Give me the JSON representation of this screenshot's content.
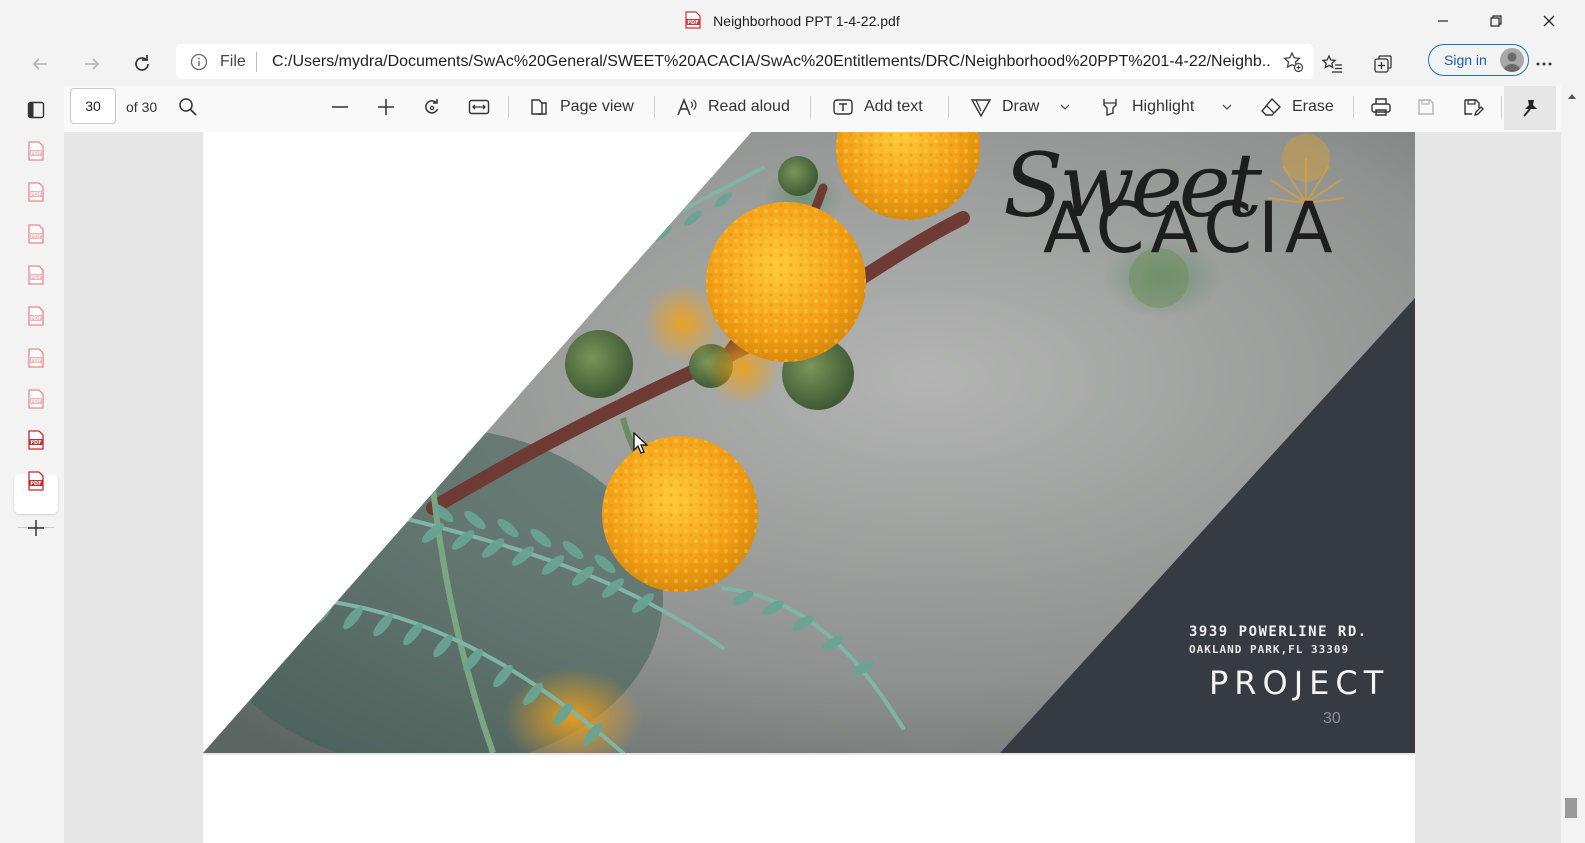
{
  "window": {
    "title": "Neighborhood PPT 1-4-22.pdf",
    "controls": [
      "minimize-icon",
      "restore-icon",
      "close-icon"
    ]
  },
  "nav": {
    "address_scheme": "File",
    "url": "C:/Users/mydra/Documents/SwAc%20General/SWEET%20ACACIA/SwAc%20Entitlements/DRC/Neighborhood%20PPT%201-4-22/Neighb...",
    "sign_in_label": "Sign in"
  },
  "pdf_toolbar": {
    "page_number": "30",
    "page_count": "of 30",
    "page_view_label": "Page view",
    "read_aloud_label": "Read aloud",
    "add_text_label": "Add text",
    "draw_label": "Draw",
    "highlight_label": "Highlight",
    "erase_label": "Erase"
  },
  "sidebar": {
    "tab_count": 9,
    "active_tab_index": 8
  },
  "slide": {
    "logo_script": "Sweet",
    "logo_caps": "ACACIA",
    "address_line1": "3939 POWERLINE RD.",
    "address_line2": "OAKLAND PARK,FL 33309",
    "project_label": "PROJECT",
    "page_number": "30"
  },
  "colors": {
    "accent": "#1a73c8",
    "pdf_red": "#d13438",
    "flower_orange": "#f0a21a",
    "slide_dark": "#363b42",
    "leaf_green": "#5f9e8b"
  }
}
